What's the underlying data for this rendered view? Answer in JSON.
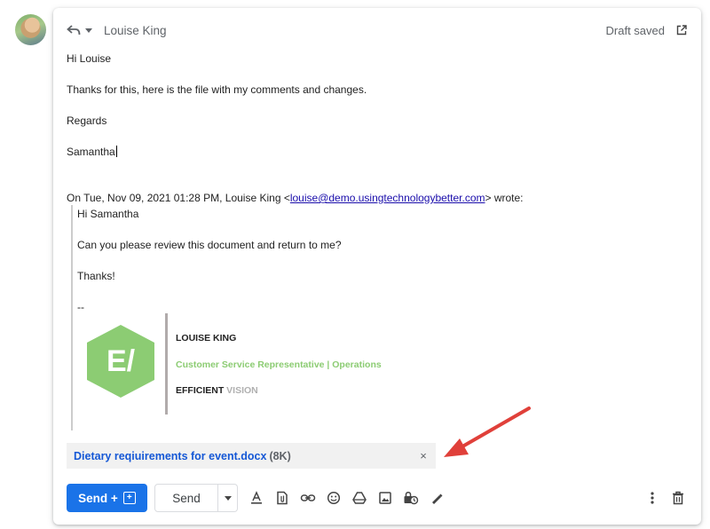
{
  "header": {
    "to_name": "Louise King",
    "draft_status": "Draft saved"
  },
  "body": {
    "greeting": "Hi Louise",
    "line1": "Thanks for this, here is the file with my comments and changes.",
    "closing": "Regards",
    "signature_name": "Samantha"
  },
  "quote": {
    "header_prefix": "On Tue, Nov 09, 2021 01:28 PM, Louise King <",
    "email": "louise@demo.usingtechnologybetter.com",
    "header_suffix": "> wrote:",
    "greeting": "Hi Samantha",
    "line1": "Can you please review this document and return to me?",
    "thanks": "Thanks!",
    "sig_sep": "--"
  },
  "signature": {
    "name": "LOUISE KING",
    "role": "Customer Service Representative | Operations",
    "company_bold": "EFFICIENT",
    "company_muted": "VISION",
    "logo_text": "E/",
    "logo_color": "#8ccc73"
  },
  "attachment": {
    "filename": "Dietary reqiuirements for event.docx",
    "size": "(8K)",
    "close": "×"
  },
  "toolbar": {
    "send_schedule_label": "Send +",
    "send_label": "Send",
    "icons": [
      "format-text-icon",
      "attach-file-icon",
      "insert-link-icon",
      "emoji-icon",
      "google-drive-icon",
      "insert-photo-icon",
      "confidential-mode-icon",
      "signature-icon",
      "more-options-icon",
      "discard-draft-icon"
    ]
  },
  "colors": {
    "accent": "#1a73e8",
    "arrow": "#e0403a",
    "link": "#1a0dab"
  }
}
